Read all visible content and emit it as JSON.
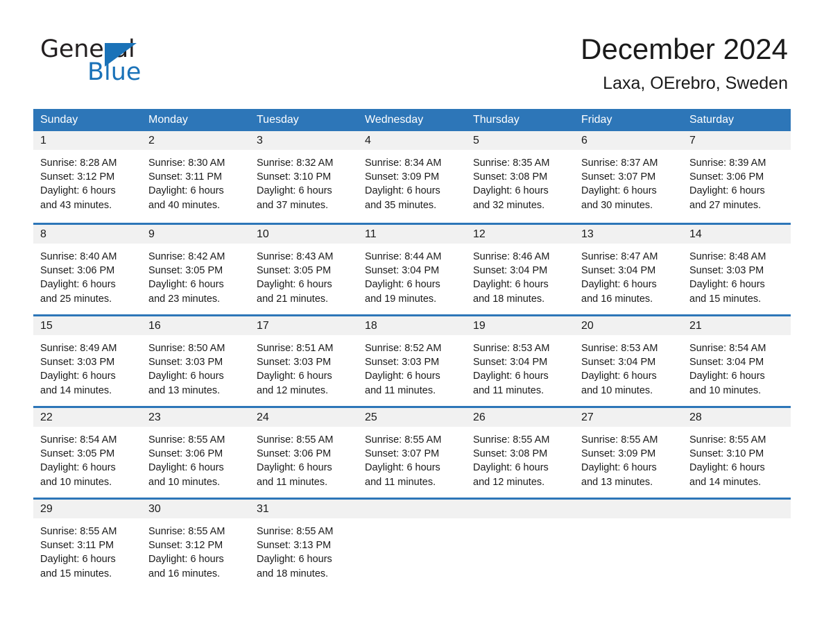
{
  "brand": {
    "name_part1": "General",
    "name_part2": "Blue",
    "triangle_color": "#1a72b8"
  },
  "header": {
    "title": "December 2024",
    "subtitle": "Laxa, OErebro, Sweden"
  },
  "theme": {
    "header_blue": "#2d76b8",
    "daynum_gray": "#f1f1f1",
    "text": "#1a1a1a"
  },
  "weekdays": [
    "Sunday",
    "Monday",
    "Tuesday",
    "Wednesday",
    "Thursday",
    "Friday",
    "Saturday"
  ],
  "weeks": [
    [
      {
        "day": "1",
        "sunrise": "Sunrise: 8:28 AM",
        "sunset": "Sunset: 3:12 PM",
        "daylight1": "Daylight: 6 hours",
        "daylight2": "and 43 minutes."
      },
      {
        "day": "2",
        "sunrise": "Sunrise: 8:30 AM",
        "sunset": "Sunset: 3:11 PM",
        "daylight1": "Daylight: 6 hours",
        "daylight2": "and 40 minutes."
      },
      {
        "day": "3",
        "sunrise": "Sunrise: 8:32 AM",
        "sunset": "Sunset: 3:10 PM",
        "daylight1": "Daylight: 6 hours",
        "daylight2": "and 37 minutes."
      },
      {
        "day": "4",
        "sunrise": "Sunrise: 8:34 AM",
        "sunset": "Sunset: 3:09 PM",
        "daylight1": "Daylight: 6 hours",
        "daylight2": "and 35 minutes."
      },
      {
        "day": "5",
        "sunrise": "Sunrise: 8:35 AM",
        "sunset": "Sunset: 3:08 PM",
        "daylight1": "Daylight: 6 hours",
        "daylight2": "and 32 minutes."
      },
      {
        "day": "6",
        "sunrise": "Sunrise: 8:37 AM",
        "sunset": "Sunset: 3:07 PM",
        "daylight1": "Daylight: 6 hours",
        "daylight2": "and 30 minutes."
      },
      {
        "day": "7",
        "sunrise": "Sunrise: 8:39 AM",
        "sunset": "Sunset: 3:06 PM",
        "daylight1": "Daylight: 6 hours",
        "daylight2": "and 27 minutes."
      }
    ],
    [
      {
        "day": "8",
        "sunrise": "Sunrise: 8:40 AM",
        "sunset": "Sunset: 3:06 PM",
        "daylight1": "Daylight: 6 hours",
        "daylight2": "and 25 minutes."
      },
      {
        "day": "9",
        "sunrise": "Sunrise: 8:42 AM",
        "sunset": "Sunset: 3:05 PM",
        "daylight1": "Daylight: 6 hours",
        "daylight2": "and 23 minutes."
      },
      {
        "day": "10",
        "sunrise": "Sunrise: 8:43 AM",
        "sunset": "Sunset: 3:05 PM",
        "daylight1": "Daylight: 6 hours",
        "daylight2": "and 21 minutes."
      },
      {
        "day": "11",
        "sunrise": "Sunrise: 8:44 AM",
        "sunset": "Sunset: 3:04 PM",
        "daylight1": "Daylight: 6 hours",
        "daylight2": "and 19 minutes."
      },
      {
        "day": "12",
        "sunrise": "Sunrise: 8:46 AM",
        "sunset": "Sunset: 3:04 PM",
        "daylight1": "Daylight: 6 hours",
        "daylight2": "and 18 minutes."
      },
      {
        "day": "13",
        "sunrise": "Sunrise: 8:47 AM",
        "sunset": "Sunset: 3:04 PM",
        "daylight1": "Daylight: 6 hours",
        "daylight2": "and 16 minutes."
      },
      {
        "day": "14",
        "sunrise": "Sunrise: 8:48 AM",
        "sunset": "Sunset: 3:03 PM",
        "daylight1": "Daylight: 6 hours",
        "daylight2": "and 15 minutes."
      }
    ],
    [
      {
        "day": "15",
        "sunrise": "Sunrise: 8:49 AM",
        "sunset": "Sunset: 3:03 PM",
        "daylight1": "Daylight: 6 hours",
        "daylight2": "and 14 minutes."
      },
      {
        "day": "16",
        "sunrise": "Sunrise: 8:50 AM",
        "sunset": "Sunset: 3:03 PM",
        "daylight1": "Daylight: 6 hours",
        "daylight2": "and 13 minutes."
      },
      {
        "day": "17",
        "sunrise": "Sunrise: 8:51 AM",
        "sunset": "Sunset: 3:03 PM",
        "daylight1": "Daylight: 6 hours",
        "daylight2": "and 12 minutes."
      },
      {
        "day": "18",
        "sunrise": "Sunrise: 8:52 AM",
        "sunset": "Sunset: 3:03 PM",
        "daylight1": "Daylight: 6 hours",
        "daylight2": "and 11 minutes."
      },
      {
        "day": "19",
        "sunrise": "Sunrise: 8:53 AM",
        "sunset": "Sunset: 3:04 PM",
        "daylight1": "Daylight: 6 hours",
        "daylight2": "and 11 minutes."
      },
      {
        "day": "20",
        "sunrise": "Sunrise: 8:53 AM",
        "sunset": "Sunset: 3:04 PM",
        "daylight1": "Daylight: 6 hours",
        "daylight2": "and 10 minutes."
      },
      {
        "day": "21",
        "sunrise": "Sunrise: 8:54 AM",
        "sunset": "Sunset: 3:04 PM",
        "daylight1": "Daylight: 6 hours",
        "daylight2": "and 10 minutes."
      }
    ],
    [
      {
        "day": "22",
        "sunrise": "Sunrise: 8:54 AM",
        "sunset": "Sunset: 3:05 PM",
        "daylight1": "Daylight: 6 hours",
        "daylight2": "and 10 minutes."
      },
      {
        "day": "23",
        "sunrise": "Sunrise: 8:55 AM",
        "sunset": "Sunset: 3:06 PM",
        "daylight1": "Daylight: 6 hours",
        "daylight2": "and 10 minutes."
      },
      {
        "day": "24",
        "sunrise": "Sunrise: 8:55 AM",
        "sunset": "Sunset: 3:06 PM",
        "daylight1": "Daylight: 6 hours",
        "daylight2": "and 11 minutes."
      },
      {
        "day": "25",
        "sunrise": "Sunrise: 8:55 AM",
        "sunset": "Sunset: 3:07 PM",
        "daylight1": "Daylight: 6 hours",
        "daylight2": "and 11 minutes."
      },
      {
        "day": "26",
        "sunrise": "Sunrise: 8:55 AM",
        "sunset": "Sunset: 3:08 PM",
        "daylight1": "Daylight: 6 hours",
        "daylight2": "and 12 minutes."
      },
      {
        "day": "27",
        "sunrise": "Sunrise: 8:55 AM",
        "sunset": "Sunset: 3:09 PM",
        "daylight1": "Daylight: 6 hours",
        "daylight2": "and 13 minutes."
      },
      {
        "day": "28",
        "sunrise": "Sunrise: 8:55 AM",
        "sunset": "Sunset: 3:10 PM",
        "daylight1": "Daylight: 6 hours",
        "daylight2": "and 14 minutes."
      }
    ],
    [
      {
        "day": "29",
        "sunrise": "Sunrise: 8:55 AM",
        "sunset": "Sunset: 3:11 PM",
        "daylight1": "Daylight: 6 hours",
        "daylight2": "and 15 minutes."
      },
      {
        "day": "30",
        "sunrise": "Sunrise: 8:55 AM",
        "sunset": "Sunset: 3:12 PM",
        "daylight1": "Daylight: 6 hours",
        "daylight2": "and 16 minutes."
      },
      {
        "day": "31",
        "sunrise": "Sunrise: 8:55 AM",
        "sunset": "Sunset: 3:13 PM",
        "daylight1": "Daylight: 6 hours",
        "daylight2": "and 18 minutes."
      },
      {
        "day": "",
        "sunrise": "",
        "sunset": "",
        "daylight1": "",
        "daylight2": ""
      },
      {
        "day": "",
        "sunrise": "",
        "sunset": "",
        "daylight1": "",
        "daylight2": ""
      },
      {
        "day": "",
        "sunrise": "",
        "sunset": "",
        "daylight1": "",
        "daylight2": ""
      },
      {
        "day": "",
        "sunrise": "",
        "sunset": "",
        "daylight1": "",
        "daylight2": ""
      }
    ]
  ]
}
